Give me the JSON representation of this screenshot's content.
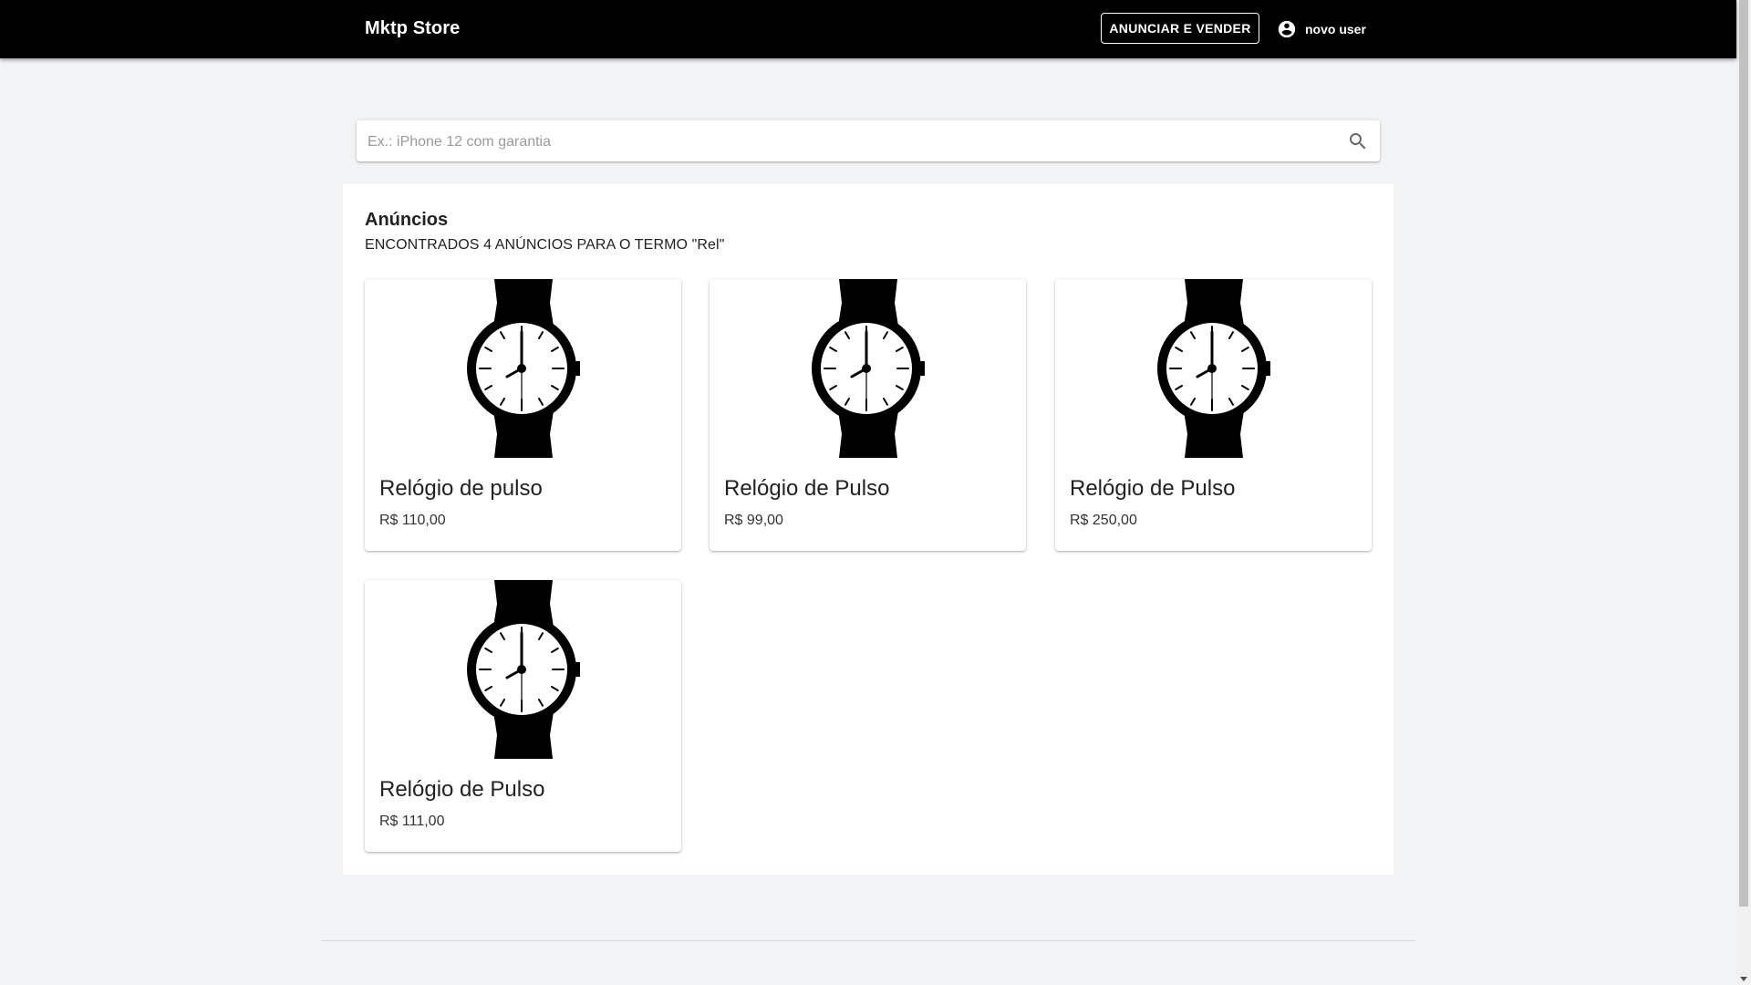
{
  "header": {
    "brand": "Mktp Store",
    "sell_button_label": "ANUNCIAR E VENDER",
    "user_name": "novo user",
    "user_icon": "account-circle-icon"
  },
  "search": {
    "placeholder": "Ex.: iPhone 12 com garantia",
    "value": "",
    "icon": "search-icon"
  },
  "results": {
    "title": "Anúncios",
    "subtitle": "ENCONTRADOS 4 ANÚNCIOS PARA O TERMO \"Rel\"",
    "items": [
      {
        "title": "Relógio de pulso",
        "price": "R$ 110,00",
        "image_icon": "wristwatch-icon"
      },
      {
        "title": "Relógio de Pulso",
        "price": "R$ 99,00",
        "image_icon": "wristwatch-icon"
      },
      {
        "title": "Relógio de Pulso",
        "price": "R$ 250,00",
        "image_icon": "wristwatch-icon"
      },
      {
        "title": "Relógio de Pulso",
        "price": "R$ 111,00",
        "image_icon": "wristwatch-icon"
      }
    ]
  },
  "colors": {
    "header_bg": "#000000",
    "page_bg": "#f2f3f4",
    "panel_bg": "#ffffff"
  }
}
